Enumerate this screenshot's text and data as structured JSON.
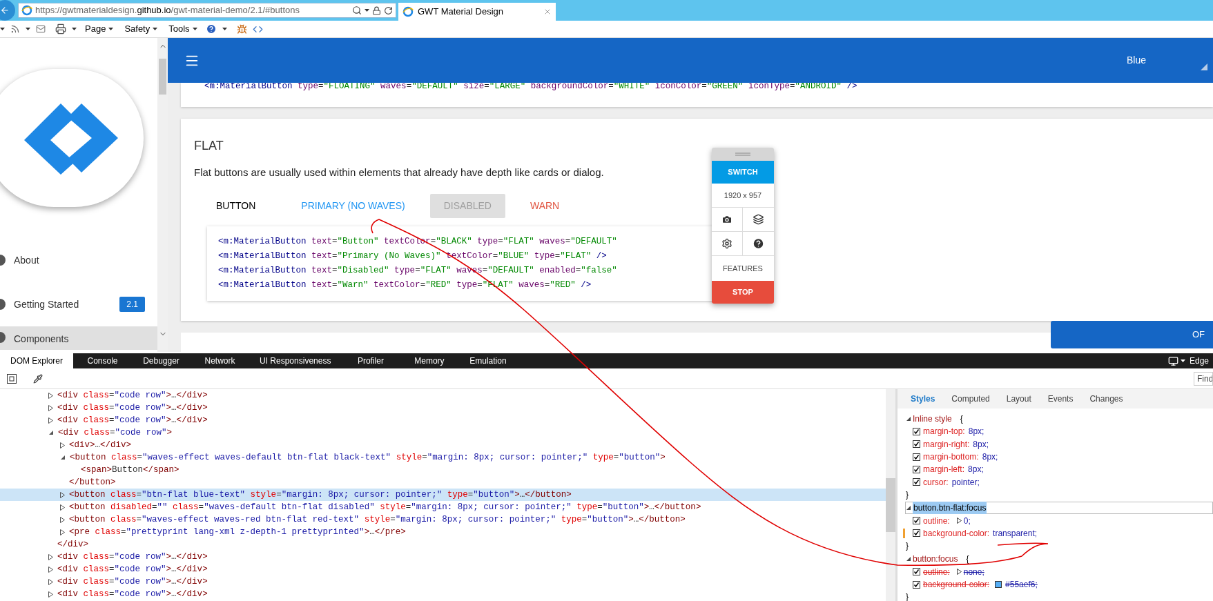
{
  "browser": {
    "url": "https://gwtmaterialdesign.**github.io**/gwt-material-demo/2.1/#buttons",
    "tab_title": "GWT Material Design",
    "menus": [
      "Page",
      "Safety",
      "Tools"
    ]
  },
  "sidebar": {
    "items": [
      {
        "label": "About",
        "selected": false
      },
      {
        "label": "Getting Started",
        "badge": "2.1",
        "selected": false
      },
      {
        "label": "Components",
        "selected": true
      }
    ]
  },
  "header": {
    "theme_label": "Blue"
  },
  "top_card": {
    "code": "<m:MaterialButton type=\"FLOATING\" waves=\"DEFAULT\" size=\"LARGE\" backgroundColor=\"WHITE\" iconColor=\"GREEN\" iconType=\"ANDROID\" />"
  },
  "flat_card": {
    "title": "FLAT",
    "description": "Flat buttons are usually used within elements that already have depth like cards or dialog.",
    "buttons": [
      {
        "label": "BUTTON",
        "kind": "black"
      },
      {
        "label": "PRIMARY (NO WAVES)",
        "kind": "primary"
      },
      {
        "label": "DISABLED",
        "kind": "disabled"
      },
      {
        "label": "WARN",
        "kind": "warn"
      }
    ],
    "code_lines": [
      "<m:MaterialButton text=\"Button\" textColor=\"BLACK\" type=\"FLAT\" waves=\"DEFAULT\"",
      "<m:MaterialButton text=\"Primary (No Waves)\" textColor=\"BLUE\" type=\"FLAT\" />",
      "<m:MaterialButton text=\"Disabled\" type=\"FLAT\" waves=\"DEFAULT\" enabled=\"false\"",
      "<m:MaterialButton text=\"Warn\" textColor=\"RED\" type=\"FLAT\" waves=\"RED\" />"
    ]
  },
  "widget": {
    "switch": "SWITCH",
    "resolution": "1920 x 957",
    "features": "FEATURES",
    "stop": "STOP"
  },
  "fab": {
    "label": "OF"
  },
  "devtools": {
    "tabs": [
      {
        "label": "DOM Explorer",
        "selected": true
      },
      {
        "label": "Console",
        "selected": false
      },
      {
        "label": "Debugger",
        "selected": false
      },
      {
        "label": "Network",
        "selected": false
      },
      {
        "label": "UI Responsiveness",
        "selected": false
      },
      {
        "label": "Profiler",
        "selected": false
      },
      {
        "label": "Memory",
        "selected": false
      },
      {
        "label": "Emulation",
        "selected": false
      }
    ],
    "target": "Edge",
    "find_placeholder": "Find",
    "dom_tree": [
      {
        "markup": "<div class=\"code row\">…</div>",
        "expanded": false,
        "selected": false
      },
      {
        "markup": "<div class=\"code row\">…</div>",
        "expanded": false,
        "selected": false
      },
      {
        "markup": "<div class=\"code row\">…</div>",
        "expanded": false,
        "selected": false
      },
      {
        "markup": "<div class=\"code row\">",
        "expanded": true,
        "selected": false,
        "close": "</div>",
        "children": [
          {
            "markup": "<div>…</div>",
            "expanded": false,
            "selected": false
          },
          {
            "markup": "<button class=\"waves-effect waves-default btn-flat black-text\" style=\"margin: 8px; cursor: pointer;\" type=\"button\">",
            "expanded": true,
            "selected": false,
            "close": "</button>",
            "children": [
              {
                "markup": "<span>Button</span>",
                "selected": false
              }
            ]
          },
          {
            "markup": "<button class=\"btn-flat blue-text\" style=\"margin: 8px; cursor: pointer;\" type=\"button\">…</button>",
            "expanded": false,
            "selected": true
          },
          {
            "markup": "<button disabled=\"\" class=\"waves-default btn-flat disabled\" style=\"margin: 8px; cursor: pointer;\" type=\"button\">…</button>",
            "expanded": false,
            "selected": false
          },
          {
            "markup": "<button class=\"waves-effect waves-red btn-flat red-text\" style=\"margin: 8px; cursor: pointer;\" type=\"button\">…</button>",
            "expanded": false,
            "selected": false
          },
          {
            "markup": "<pre class=\"prettyprint lang-xml z-depth-1 prettyprinted\">…</pre>",
            "expanded": false,
            "selected": false
          }
        ]
      },
      {
        "markup": "<div class=\"code row\">…</div>",
        "expanded": false,
        "selected": false
      },
      {
        "markup": "<div class=\"code row\">…</div>",
        "expanded": false,
        "selected": false
      },
      {
        "markup": "<div class=\"code row\">…</div>",
        "expanded": false,
        "selected": false
      },
      {
        "markup": "<div class=\"code row\">…</div>",
        "expanded": false,
        "selected": false
      }
    ],
    "style_tabs": [
      {
        "label": "Styles",
        "selected": true
      },
      {
        "label": "Computed",
        "selected": false
      },
      {
        "label": "Layout",
        "selected": false
      },
      {
        "label": "Events",
        "selected": false
      },
      {
        "label": "Changes",
        "selected": false
      }
    ],
    "rules": [
      {
        "selector": "Inline style",
        "open": "{",
        "close": "}",
        "selected": false,
        "props": [
          {
            "name": "margin-top:",
            "value": "8px;",
            "checked": true,
            "overridden": false,
            "modified": false,
            "shorthand": false
          },
          {
            "name": "margin-right:",
            "value": "8px;",
            "checked": true,
            "overridden": false,
            "modified": false,
            "shorthand": false
          },
          {
            "name": "margin-bottom:",
            "value": "8px;",
            "checked": true,
            "overridden": false,
            "modified": false,
            "shorthand": false
          },
          {
            "name": "margin-left:",
            "value": "8px;",
            "checked": true,
            "overridden": false,
            "modified": false,
            "shorthand": false
          },
          {
            "name": "cursor:",
            "value": "pointer;",
            "checked": true,
            "overridden": false,
            "modified": false,
            "shorthand": false
          }
        ]
      },
      {
        "selector": "button.btn-flat:focus",
        "close": "}",
        "selected": true,
        "props": [
          {
            "name": "outline:",
            "value": "0;",
            "checked": true,
            "overridden": false,
            "modified": false,
            "shorthand": true
          },
          {
            "name": "background-color:",
            "value": "transparent;",
            "checked": true,
            "overridden": false,
            "modified": true,
            "shorthand": false
          }
        ]
      },
      {
        "selector": "button:focus",
        "open": "{",
        "close": "}",
        "selected": false,
        "props": [
          {
            "name": "outline:",
            "value": "none;",
            "checked": true,
            "overridden": true,
            "modified": false,
            "shorthand": true
          },
          {
            "name": "background-color:",
            "value": "#55aef6;",
            "kind": "color",
            "checked": true,
            "overridden": true,
            "modified": false,
            "shorthand": false
          }
        ]
      }
    ]
  }
}
